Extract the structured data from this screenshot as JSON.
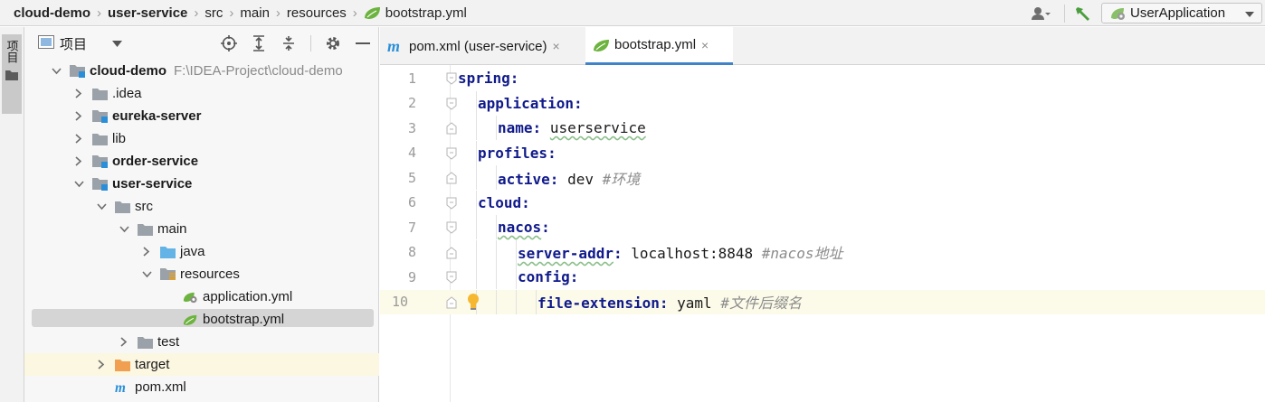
{
  "breadcrumb": [
    "cloud-demo",
    "user-service",
    "src",
    "main",
    "resources",
    "bootstrap.yml"
  ],
  "run_config": {
    "label": "UserApplication"
  },
  "toolstrip": {
    "project_tab_label": "项目"
  },
  "project_panel": {
    "title": "项目"
  },
  "tree": [
    {
      "label": "cloud-demo",
      "path_hint": "F:\\IDEA-Project\\cloud-demo",
      "bold": true,
      "depth": 0,
      "arrow": "down",
      "icon": "module-folder-icon"
    },
    {
      "label": ".idea",
      "bold": false,
      "depth": 1,
      "arrow": "right",
      "icon": "folder-icon"
    },
    {
      "label": "eureka-server",
      "bold": true,
      "depth": 1,
      "arrow": "right",
      "icon": "module-folder-icon"
    },
    {
      "label": "lib",
      "bold": false,
      "depth": 1,
      "arrow": "right",
      "icon": "folder-icon"
    },
    {
      "label": "order-service",
      "bold": true,
      "depth": 1,
      "arrow": "right",
      "icon": "module-folder-icon"
    },
    {
      "label": "user-service",
      "bold": true,
      "depth": 1,
      "arrow": "down",
      "icon": "module-folder-icon"
    },
    {
      "label": "src",
      "bold": false,
      "depth": 2,
      "arrow": "down",
      "icon": "folder-icon"
    },
    {
      "label": "main",
      "bold": false,
      "depth": 3,
      "arrow": "down",
      "icon": "folder-icon"
    },
    {
      "label": "java",
      "bold": false,
      "depth": 4,
      "arrow": "right",
      "icon": "source-folder-icon"
    },
    {
      "label": "resources",
      "bold": false,
      "depth": 4,
      "arrow": "down",
      "icon": "resources-folder-icon"
    },
    {
      "label": "application.yml",
      "bold": false,
      "depth": 5,
      "arrow": "none",
      "icon": "spring-config-icon"
    },
    {
      "label": "bootstrap.yml",
      "bold": false,
      "depth": 5,
      "arrow": "none",
      "icon": "spring-yaml-icon",
      "selected": true
    },
    {
      "label": "test",
      "bold": false,
      "depth": 3,
      "arrow": "right",
      "icon": "folder-icon"
    },
    {
      "label": "target",
      "bold": false,
      "depth": 2,
      "arrow": "right",
      "icon": "excluded-folder-icon",
      "highlight": true
    },
    {
      "label": "pom.xml",
      "bold": false,
      "depth": 2,
      "arrow": "none",
      "icon": "maven-icon"
    }
  ],
  "tabs": [
    {
      "label": "pom.xml (user-service)",
      "icon": "maven-icon",
      "active": false
    },
    {
      "label": "bootstrap.yml",
      "icon": "spring-yaml-icon",
      "active": true
    }
  ],
  "code_lines": [
    {
      "n": "1",
      "indent": 0,
      "key": "spring",
      "value": "",
      "comment": ""
    },
    {
      "n": "2",
      "indent": 1,
      "key": "application",
      "value": "",
      "comment": ""
    },
    {
      "n": "3",
      "indent": 2,
      "key": "name",
      "value": "userservice",
      "comment": ""
    },
    {
      "n": "4",
      "indent": 1,
      "key": "profiles",
      "value": "",
      "comment": ""
    },
    {
      "n": "5",
      "indent": 2,
      "key": "active",
      "value": "dev",
      "comment": "#环境"
    },
    {
      "n": "6",
      "indent": 1,
      "key": "cloud",
      "value": "",
      "comment": ""
    },
    {
      "n": "7",
      "indent": 2,
      "key": "nacos",
      "value": "",
      "comment": ""
    },
    {
      "n": "8",
      "indent": 3,
      "key": "server-addr",
      "value": "localhost:8848",
      "comment": "#nacos地址"
    },
    {
      "n": "9",
      "indent": 3,
      "key": "config",
      "value": "",
      "comment": ""
    },
    {
      "n": "10",
      "indent": 4,
      "key": "file-extension",
      "value": "yaml",
      "comment": "#文件后缀名",
      "current": true
    }
  ],
  "colors": {
    "accent": "#4083c9",
    "key": "#101a8b",
    "comment": "#8c8c8c",
    "spring_green": "#6db33f",
    "maven_blue": "#2a8fd8"
  }
}
